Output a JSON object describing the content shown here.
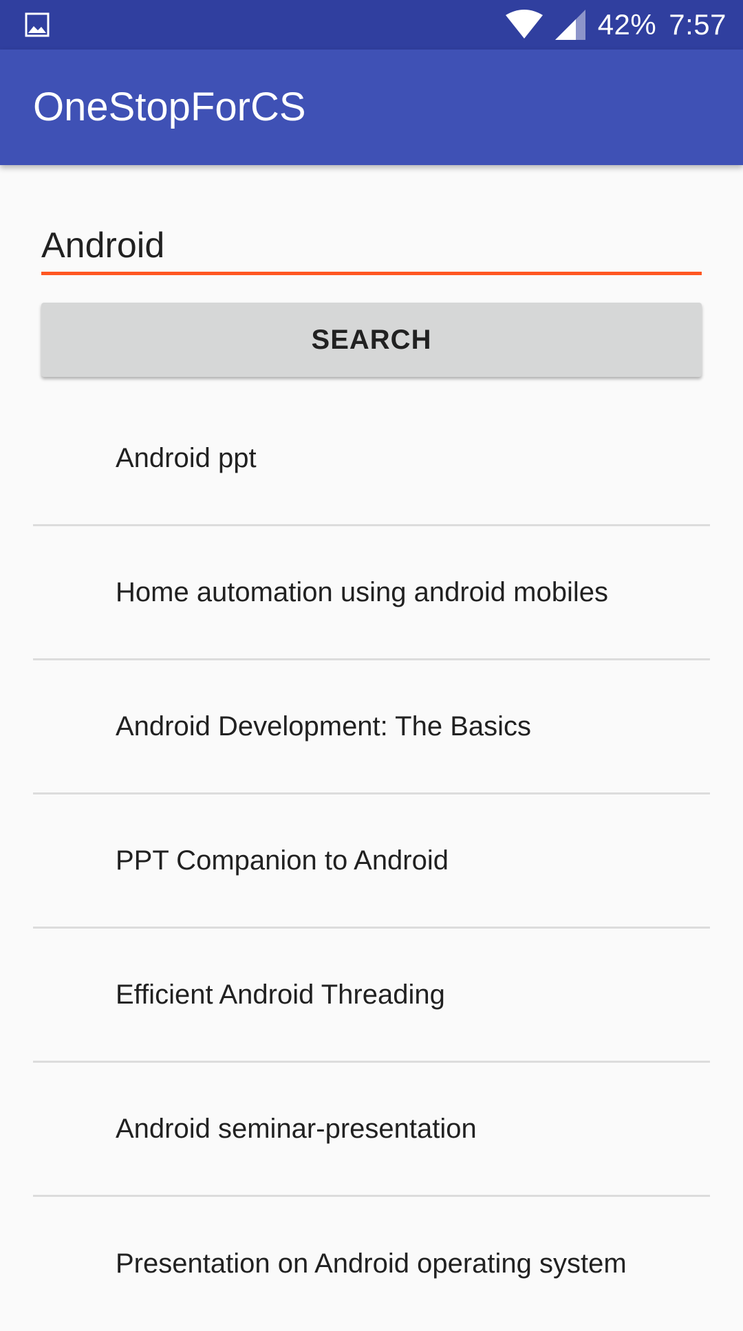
{
  "status_bar": {
    "left_icon": "image-icon",
    "battery": "42%",
    "time": "7:57",
    "icons": [
      "wifi-icon",
      "cellular-signal-icon"
    ]
  },
  "app_bar": {
    "title": "OneStopForCS",
    "color": "#3f51b5"
  },
  "search": {
    "value": "Android",
    "accent_color": "#ff5722",
    "button_label": "SEARCH"
  },
  "results": [
    {
      "label": "Android ppt"
    },
    {
      "label": "Home automation using android mobiles"
    },
    {
      "label": "Android Development: The Basics"
    },
    {
      "label": "PPT Companion to Android"
    },
    {
      "label": "Efficient Android Threading"
    },
    {
      "label": "Android seminar-presentation"
    },
    {
      "label": "Presentation on Android operating system"
    }
  ]
}
